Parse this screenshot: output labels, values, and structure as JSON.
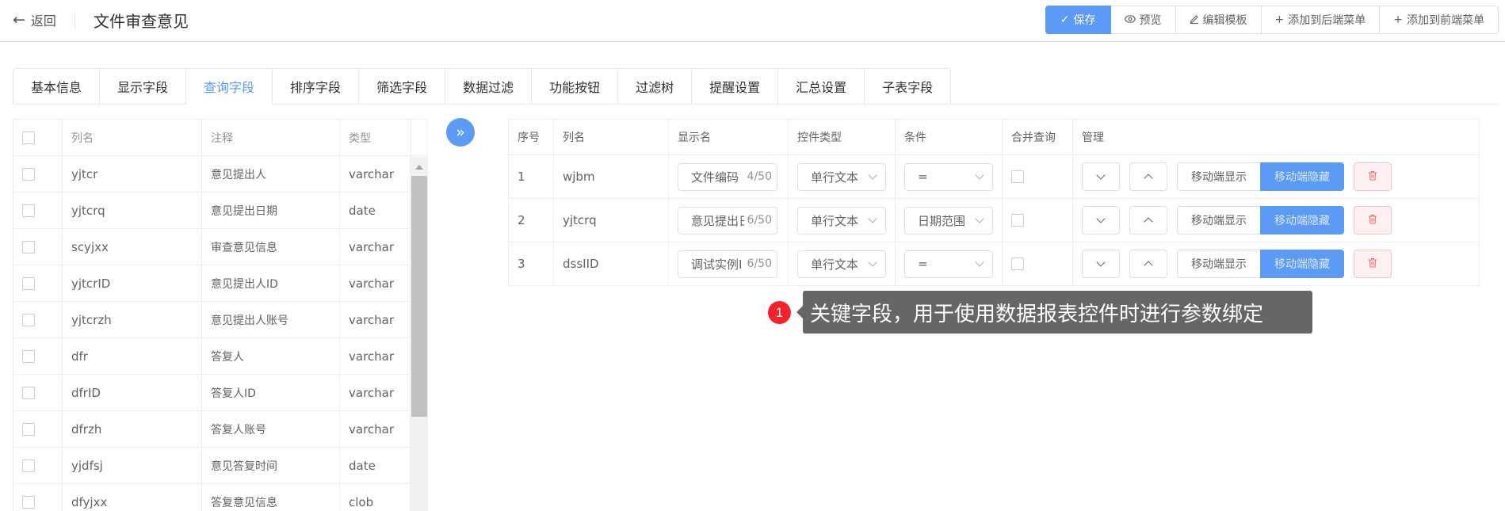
{
  "header": {
    "back_label": "返回",
    "title": "文件审查意见",
    "toolbar": [
      {
        "label": "保存",
        "icon": "check-icon",
        "primary": true
      },
      {
        "label": "预览",
        "icon": "eye-icon"
      },
      {
        "label": "编辑模板",
        "icon": "edit-icon"
      },
      {
        "label": "添加到后端菜单",
        "icon": "plus-icon"
      },
      {
        "label": "添加到前端菜单",
        "icon": "plus-icon"
      }
    ]
  },
  "tabs": [
    {
      "label": "基本信息"
    },
    {
      "label": "显示字段"
    },
    {
      "label": "查询字段",
      "active": true
    },
    {
      "label": "排序字段"
    },
    {
      "label": "筛选字段"
    },
    {
      "label": "数据过滤"
    },
    {
      "label": "功能按钮"
    },
    {
      "label": "过滤树"
    },
    {
      "label": "提醒设置"
    },
    {
      "label": "汇总设置"
    },
    {
      "label": "子表字段"
    }
  ],
  "left_table": {
    "columns": [
      "列名",
      "注释",
      "类型"
    ],
    "rows": [
      {
        "col": "yjtcr",
        "note": "意见提出人",
        "type": "varchar"
      },
      {
        "col": "yjtcrq",
        "note": "意见提出日期",
        "type": "date"
      },
      {
        "col": "scyjxx",
        "note": "审查意见信息",
        "type": "varchar"
      },
      {
        "col": "yjtcrID",
        "note": "意见提出人ID",
        "type": "varchar"
      },
      {
        "col": "yjtcrzh",
        "note": "意见提出人账号",
        "type": "varchar"
      },
      {
        "col": "dfr",
        "note": "答复人",
        "type": "varchar"
      },
      {
        "col": "dfrID",
        "note": "答复人ID",
        "type": "varchar"
      },
      {
        "col": "dfrzh",
        "note": "答复人账号",
        "type": "varchar"
      },
      {
        "col": "yjdfsj",
        "note": "意见答复时间",
        "type": "date"
      },
      {
        "col": "dfyjxx",
        "note": "答复意见信息",
        "type": "clob"
      }
    ]
  },
  "right_table": {
    "columns": [
      "序号",
      "列名",
      "显示名",
      "控件类型",
      "条件",
      "合并查询",
      "管理"
    ],
    "rows": [
      {
        "no": "1",
        "col": "wjbm",
        "display": "文件编码",
        "count": "4/50",
        "ctype": "单行文本",
        "cond": "="
      },
      {
        "no": "2",
        "col": "yjtcrq",
        "display": "意见提出日",
        "count": "6/50",
        "ctype": "单行文本",
        "cond": "日期范围"
      },
      {
        "no": "3",
        "col": "dssIID",
        "display": "调试实例I",
        "count": "6/50",
        "ctype": "单行文本",
        "cond": "="
      }
    ],
    "mobile_show_label": "移动端显示",
    "mobile_hide_label": "移动端隐藏"
  },
  "tooltip": {
    "badge": "1",
    "text": "关键字段，用于使用数据报表控件时进行参数绑定"
  },
  "colors": {
    "primary": "#5b9af5",
    "danger": "#f5222d",
    "tooltip_bg": "#666666"
  }
}
